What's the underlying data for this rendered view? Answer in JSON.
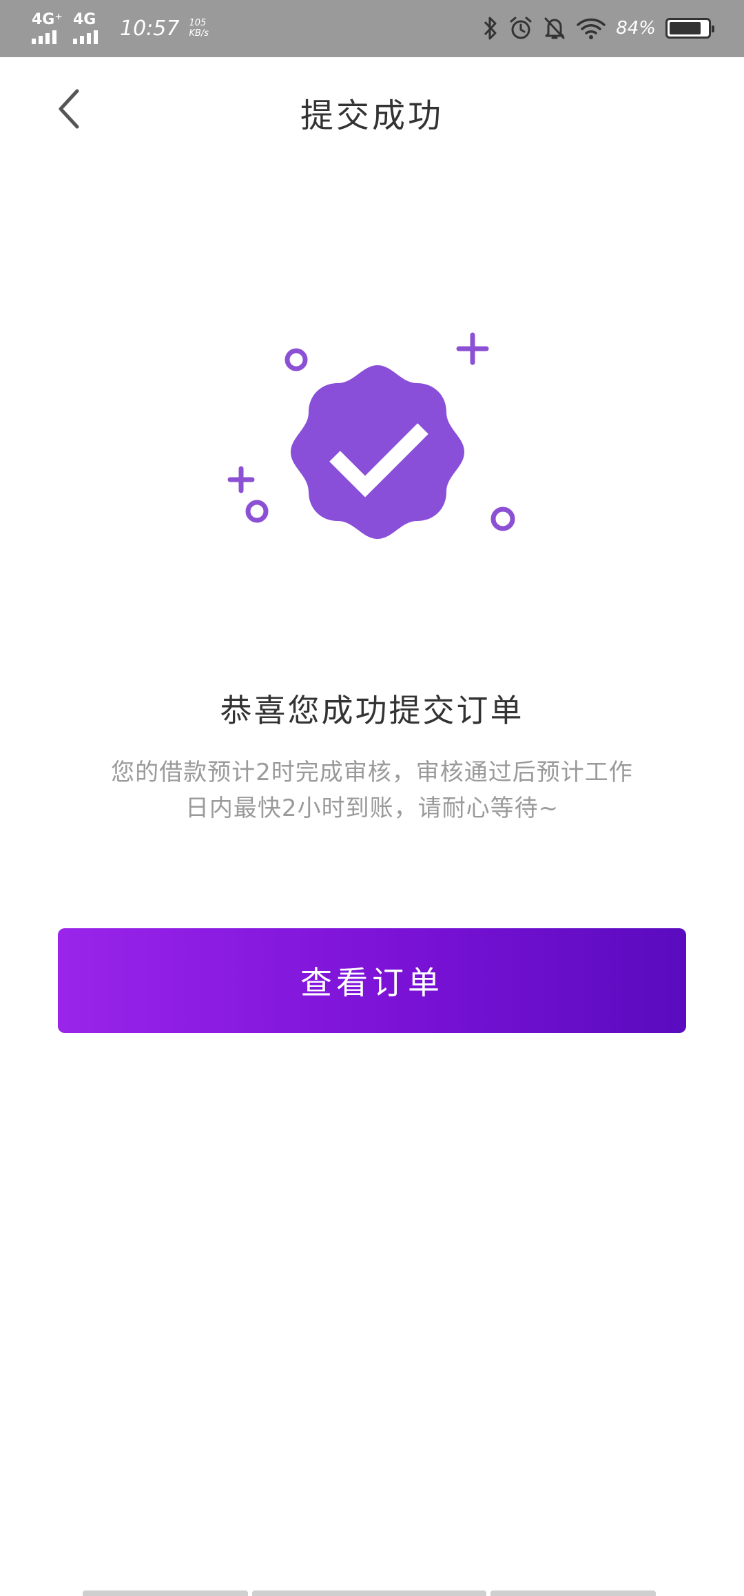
{
  "status_bar": {
    "network_1": "4G⁺",
    "network_2": "4G",
    "time": "10:57",
    "speed_value": "105",
    "speed_unit": "KB/s",
    "battery_percent": "84%",
    "battery_level": 0.84,
    "icons": [
      "bluetooth-icon",
      "alarm-icon",
      "mute-bell-icon",
      "wifi-icon",
      "battery-icon"
    ]
  },
  "header": {
    "title": "提交成功",
    "back_icon": "chevron-left-icon"
  },
  "illustration": {
    "icon": "verified-badge-check-icon",
    "colors": {
      "badge": "#8a4fd8",
      "accent": "#8c50d4"
    }
  },
  "message": {
    "headline": "恭喜您成功提交订单",
    "description_line1": "您的借款预计2时完成审核，审核通过后预计工作",
    "description_line2": "日内最快2小时到账，请耐心等待~"
  },
  "actions": {
    "view_order_label": "查看订单"
  },
  "colors": {
    "status_bar_bg": "#9a9a9a",
    "button_gradient_start": "#9a24ea",
    "button_gradient_end": "#5a0bbf",
    "text_primary": "#333333",
    "text_secondary": "#9a9a9a"
  }
}
